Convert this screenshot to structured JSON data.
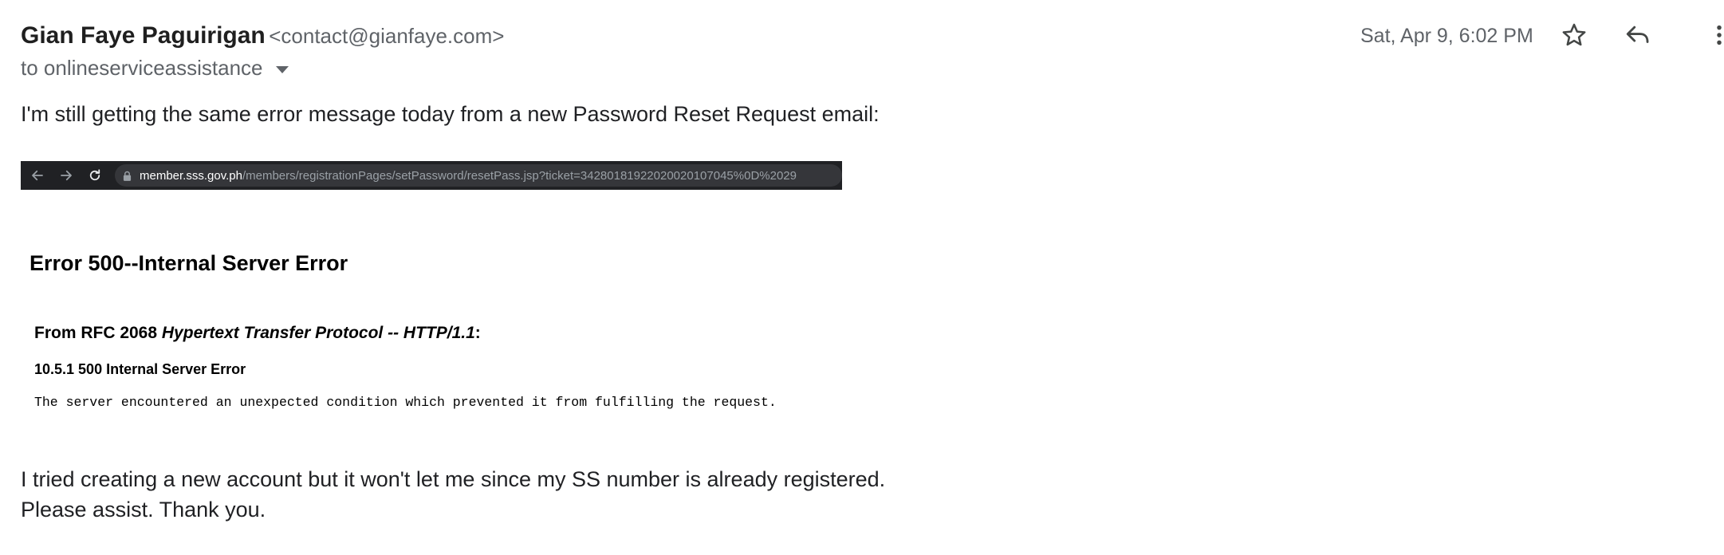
{
  "header": {
    "sender_name": "Gian Faye Paguirigan",
    "sender_email": "<contact@gianfaye.com>",
    "to_label": "to onlineserviceassistance",
    "date": "Sat, Apr 9, 6:02 PM",
    "icons": [
      "star-icon",
      "reply-icon",
      "more-vert-icon",
      "chevron-down-icon"
    ]
  },
  "body": {
    "intro": "I'm still getting the same error message today from a new Password Reset Request email:",
    "closing_line1": "I tried creating a new account but it won't let me since my SS number is already registered.",
    "closing_line2": "Please assist. Thank you."
  },
  "screenshot": {
    "url_domain": "member.sss.gov.ph",
    "url_path": "/members/registrationPages/setPassword/resetPass.jsp?ticket=34280181922020020107045%0D%2029",
    "error_title": "Error 500--Internal Server Error",
    "rfc_prefix": "From RFC 2068 ",
    "rfc_italic": "Hypertext Transfer Protocol -- HTTP/1.1",
    "rfc_suffix": ":",
    "section_heading": "10.5.1 500 Internal Server Error",
    "description": "The server encountered an unexpected condition which prevented it from fulfilling the request."
  },
  "colors": {
    "browser_bar": "#202124",
    "url_pill": "#35363a",
    "secondary_text": "#5f6368"
  }
}
